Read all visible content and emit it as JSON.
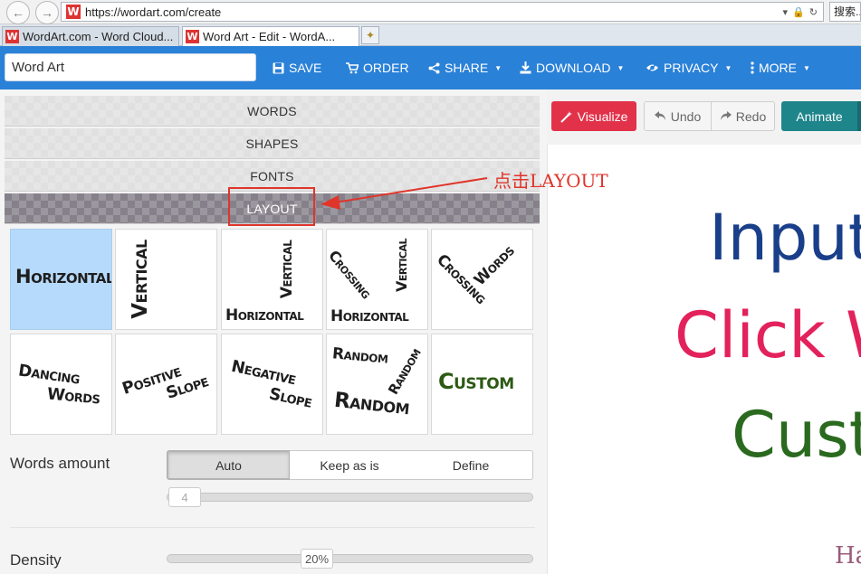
{
  "browser": {
    "url": "https://wordart.com/create",
    "favicon_letter": "W",
    "search_placeholder": "搜索...",
    "tabs": [
      {
        "label": "WordArt.com - Word Cloud..."
      },
      {
        "label": "Word Art - Edit - WordA..."
      }
    ]
  },
  "toolbar": {
    "title_value": "Word Art",
    "save": "SAVE",
    "order": "ORDER",
    "share": "SHARE",
    "download": "DOWNLOAD",
    "privacy": "PRIVACY",
    "more": "MORE"
  },
  "sections": {
    "words": "WORDS",
    "shapes": "SHAPES",
    "fonts": "FONTS",
    "layout": "LAYOUT"
  },
  "annotation": {
    "text": "点击LAYOUT"
  },
  "layout_options": {
    "horizontal": {
      "w1": "Horizontal"
    },
    "vertical": {
      "w1": "Vertical"
    },
    "hv": {
      "w1": "Vertical",
      "w2": "Horizontal"
    },
    "crossing_hv": {
      "w1": "Crossing",
      "w2": "Vertical",
      "w3": "Horizontal"
    },
    "crossing_words": {
      "w1": "Crossing",
      "w2": "Words"
    },
    "dancing": {
      "w1": "Dancing",
      "w2": "Words"
    },
    "positive": {
      "w1": "Positive",
      "w2": "Slope"
    },
    "negative": {
      "w1": "Negative",
      "w2": "Slope"
    },
    "random": {
      "w1": "Random",
      "w2": "Random",
      "w3": "Random"
    },
    "custom": {
      "w1": "Custom"
    }
  },
  "words_amount": {
    "label": "Words amount",
    "options": [
      "Auto",
      "Keep as is",
      "Define"
    ],
    "selected": "Auto",
    "value": "4"
  },
  "density": {
    "label": "Density",
    "value": "20%"
  },
  "right_toolbar": {
    "visualize": "Visualize",
    "undo": "Undo",
    "redo": "Redo",
    "animate": "Animate"
  },
  "canvas_words": {
    "w1": "Input",
    "w2": "Click W",
    "w3": "Cust",
    "w4": "Ha"
  },
  "colors": {
    "accent": "#2a81d8",
    "visualize": "#e2324a",
    "animate": "#1e858b",
    "layout_active": "#85808a",
    "selected_tile": "#b6dafb",
    "annotation": "#e0352b",
    "canvas_word1": "#1a3f8a",
    "canvas_word2": "#e3225c",
    "canvas_word3": "#2a6a1f",
    "canvas_word4": "#9a5c7a",
    "custom_word": "#2c5a14"
  }
}
